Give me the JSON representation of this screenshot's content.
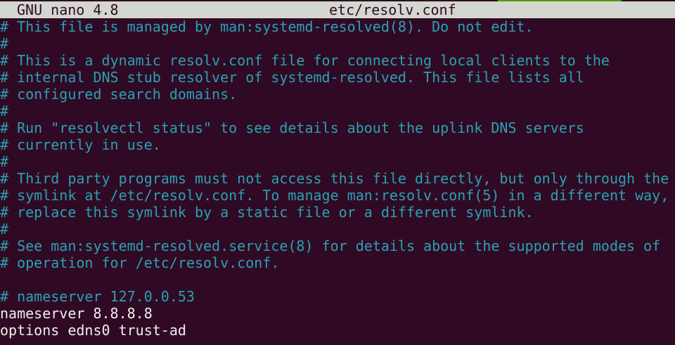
{
  "titlebar": {
    "app": "GNU nano 4.8",
    "filename": "etc/resolv.conf",
    "accent_color": "#4e9a06"
  },
  "colors": {
    "background": "#300a24",
    "titlebar_bg": "#d3d7cf",
    "comment": "#2aa1b3",
    "text": "#eeeeec"
  },
  "lines": [
    {
      "text": "# This file is managed by man:systemd-resolved(8). Do not edit.",
      "kind": "comment"
    },
    {
      "text": "#",
      "kind": "comment"
    },
    {
      "text": "# This is a dynamic resolv.conf file for connecting local clients to the",
      "kind": "comment"
    },
    {
      "text": "# internal DNS stub resolver of systemd-resolved. This file lists all",
      "kind": "comment"
    },
    {
      "text": "# configured search domains.",
      "kind": "comment"
    },
    {
      "text": "#",
      "kind": "comment"
    },
    {
      "text": "# Run \"resolvectl status\" to see details about the uplink DNS servers",
      "kind": "comment"
    },
    {
      "text": "# currently in use.",
      "kind": "comment"
    },
    {
      "text": "#",
      "kind": "comment"
    },
    {
      "text": "# Third party programs must not access this file directly, but only through the",
      "kind": "comment"
    },
    {
      "text": "# symlink at /etc/resolv.conf. To manage man:resolv.conf(5) in a different way,",
      "kind": "comment"
    },
    {
      "text": "# replace this symlink by a static file or a different symlink.",
      "kind": "comment"
    },
    {
      "text": "#",
      "kind": "comment"
    },
    {
      "text": "# See man:systemd-resolved.service(8) for details about the supported modes of",
      "kind": "comment"
    },
    {
      "text": "# operation for /etc/resolv.conf.",
      "kind": "comment"
    },
    {
      "text": "",
      "kind": "plain"
    },
    {
      "text": "# nameserver 127.0.0.53",
      "kind": "comment"
    },
    {
      "text": "nameserver 8.8.8.8",
      "kind": "plain"
    },
    {
      "text": "options edns0 trust-ad",
      "kind": "plain"
    }
  ]
}
